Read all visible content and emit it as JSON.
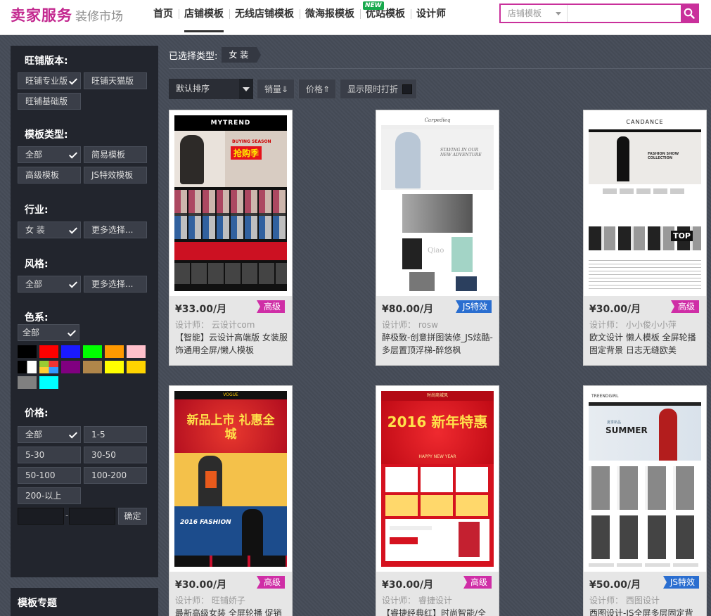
{
  "header": {
    "logo_main": "卖家服务",
    "logo_sub": "装修市场",
    "nav": [
      "首页",
      "店铺模板",
      "无线店铺模板",
      "微海报模板",
      "优站模板",
      "设计师"
    ],
    "new_badge": "NEW",
    "search": {
      "select_value": "店铺模板",
      "placeholder": ""
    }
  },
  "sidebar": {
    "version": {
      "title": "旺铺版本:",
      "options": [
        "旺铺专业版",
        "旺铺天猫版",
        "旺铺基础版"
      ]
    },
    "template_type": {
      "title": "模板类型:",
      "options": [
        "全部",
        "简易模板",
        "高级模板",
        "JS特效模板"
      ]
    },
    "industry": {
      "title": "行业:",
      "options": [
        "女 装",
        "更多选择..."
      ]
    },
    "style": {
      "title": "风格:",
      "options": [
        "全部",
        "更多选择..."
      ]
    },
    "color": {
      "title": "色系:",
      "all_label": "全部",
      "swatches": [
        "#000000",
        "#ff0000",
        "#1a1aff",
        "#00ff00",
        "#ff9900",
        "#ffc0cb",
        "multi-bw",
        "multi-color",
        "#800080",
        "#b0864a",
        "#ffff00",
        "#ffd400",
        "#808080",
        "#00ffff"
      ]
    },
    "price": {
      "title": "价格:",
      "options": [
        "全部",
        "1-5",
        "5-30",
        "30-50",
        "50-100",
        "100-200",
        "200-以上"
      ],
      "confirm": "确定"
    },
    "topic_title": "模板专题"
  },
  "main": {
    "selected_label": "已选择类型:",
    "selected_tag": "女 装",
    "sort": {
      "default": "默认排序",
      "sales": "销量⇓",
      "price": "价格⇑",
      "limit": "显示限时打折"
    }
  },
  "cards": [
    {
      "price": "¥33.00/月",
      "badge": "高级",
      "designer": "设计师： 云设计com",
      "desc": "【智能】云设计高端版 女装服饰通用全屏/懒人模板",
      "thumb_title": "MYTREND",
      "thumb_text": "抢购季",
      "thumb_sub": "BUYING SEASON"
    },
    {
      "price": "¥80.00/月",
      "badge": "JS特效",
      "designer": "设计师： rosw",
      "desc": "醉极致-创意拼图装修_JS炫酷-多层置顶浮梯-醉悠枫",
      "thumb_title": "Carpedieq",
      "thumb_text": "STAYING IN OUR NEW ADVENTURE",
      "thumb_sub": "Qiao"
    },
    {
      "price": "¥30.00/月",
      "badge": "高级",
      "designer": "设计师： 小小俊小小萍",
      "desc": "欧文设计 懒人模板 全屏轮播 固定背景 日志无缝欧美",
      "thumb_title": "CANDANCE",
      "thumb_text": "FASHION SHOW COLLECTION",
      "thumb_sub": "TOP"
    },
    {
      "price": "¥30.00/月",
      "badge": "高级",
      "designer": "设计师： 旺铺娇子",
      "desc": "最新高级女装 全屏轮播 促销",
      "thumb_title": "VOGUE",
      "thumb_text": "新品上市 礼惠全城",
      "thumb_sub": "2016 FASHION"
    },
    {
      "price": "¥30.00/月",
      "badge": "高级",
      "designer": "设计师： 睿捷设计",
      "desc": "【睿捷经典红】时尚智能/全",
      "thumb_title": "时尚商城风",
      "thumb_text": "2016 新年特惠",
      "thumb_sub": "HAPPY NEW YEAR"
    },
    {
      "price": "¥50.00/月",
      "badge": "JS特效",
      "designer": "设计师： 西图设计",
      "desc": "西图设计-JS全屏多层固定背",
      "thumb_title": "TREENDGIRL",
      "thumb_text": "SUMMER",
      "thumb_sub": "夏季新品"
    }
  ],
  "colors": {
    "accent": "#c9309b",
    "badge_pink": "#cf2ea6",
    "badge_blue": "#2a6ed0",
    "sidebar_bg": "#22252d"
  }
}
